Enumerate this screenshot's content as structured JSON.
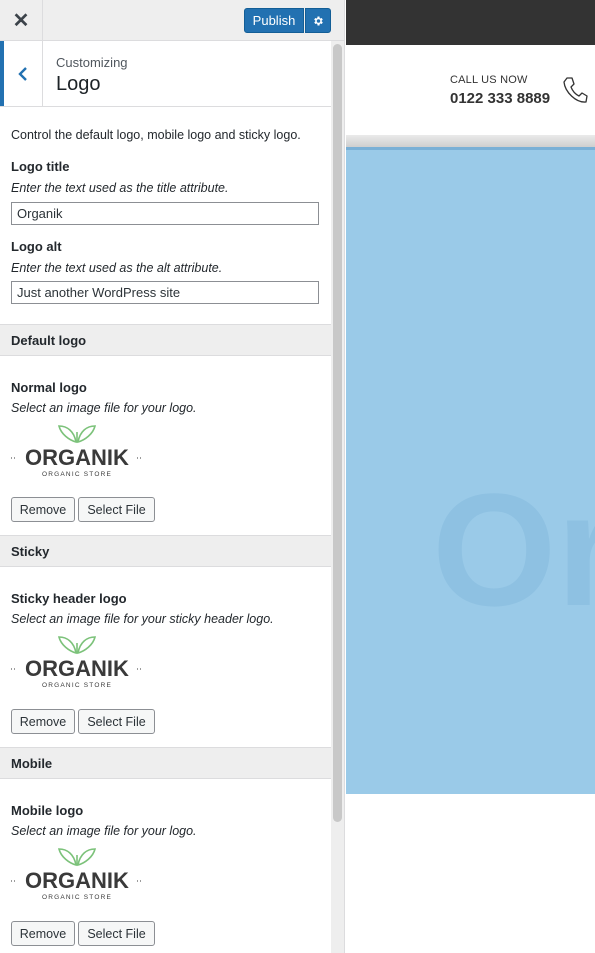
{
  "topbar": {
    "close_icon": "close-icon",
    "publish_label": "Publish",
    "settings_icon": "gear-icon"
  },
  "section": {
    "breadcrumb": "Customizing",
    "title": "Logo",
    "back_icon": "chevron-left-icon"
  },
  "panel": {
    "description": "Control the default logo, mobile logo and sticky logo.",
    "logo_title": {
      "label": "Logo title",
      "help": "Enter the text used as the title attribute.",
      "value": "Organik"
    },
    "logo_alt": {
      "label": "Logo alt",
      "help": "Enter the text used as the alt attribute.",
      "value": "Just another WordPress site"
    }
  },
  "groups": [
    {
      "heading": "Default logo",
      "label": "Normal logo",
      "help": "Select an image file for your logo.",
      "remove_label": "Remove",
      "select_label": "Select File"
    },
    {
      "heading": "Sticky",
      "label": "Sticky header logo",
      "help": "Select an image file for your sticky header logo.",
      "remove_label": "Remove",
      "select_label": "Select File"
    },
    {
      "heading": "Mobile",
      "label": "Mobile logo",
      "help": "Select an image file for your logo.",
      "remove_label": "Remove",
      "select_label": "Select File"
    }
  ],
  "logo_image": {
    "brand": "ORGANIK",
    "tagline": "ORGANIC STORE",
    "leaf_color": "#7cc27a",
    "text_color": "#3a3a3a"
  },
  "preview": {
    "call_label": "CALL US NOW",
    "call_number": "0122 333 8889",
    "phone_icon": "phone-icon",
    "hero_text": "Or",
    "hero_color": "#9acae8"
  },
  "colors": {
    "accent": "#2271b1",
    "admin_bar": "#333333"
  }
}
